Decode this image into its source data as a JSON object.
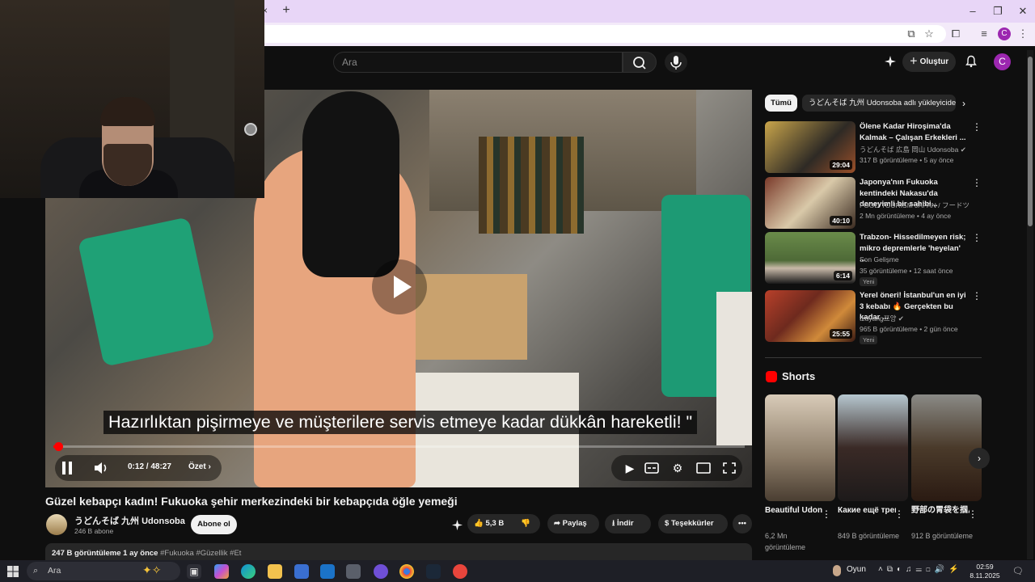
{
  "browser": {
    "tab_close": "×",
    "new_tab": "+",
    "window_controls": {
      "minimize": "–",
      "restore": "❐",
      "close": "✕"
    },
    "profile_initial": "C"
  },
  "header": {
    "search_placeholder": "Ara",
    "create_label": "Oluştur",
    "avatar_initial": "C"
  },
  "player": {
    "subtitle": "Hazırlıktan pişirmeye ve müşterilere servis etmeye kadar dükkân hareketli! \"",
    "time": "0:12 / 48:27",
    "chapter": "Özet",
    "progress": 0.004,
    "state": "paused-hover"
  },
  "video": {
    "title": "Güzel kebapçı kadın! Fukuoka şehir merkezindeki bir kebapçıda öğle yemeği",
    "channel": "うどんそば 九州 Udonsoba",
    "subscribers": "246 B abone",
    "subscribe_label": "Abone ol",
    "likes": "5,3 B",
    "share_label": "Paylaş",
    "download_label": "İndir",
    "thanks_label": "Teşekkürler",
    "views_age": "247 B görüntüleme  1 ay önce",
    "tags": "#Fukuoka #Güzellik #Et"
  },
  "sidebar": {
    "chips": [
      "Tümü",
      "うどんそば 九州 Udonsoba adlı yükleyiciden"
    ],
    "recommendations": [
      {
        "title": "Ölene Kadar Hiroşima'da Kalmak – Çalışan Erkekleri ...",
        "channel": "うどんそば 広島 岡山 Udonsoba ✔",
        "meta": "317 B görüntüleme • 5 ay önce",
        "duration": "29:04",
        "badge": ""
      },
      {
        "title": "Japonya'nın Fukuoka kentindeki Nakasu'da deneyimli bir sahibi...",
        "channel": "FOOD TOURISM JAPAN / フードツーリ...",
        "meta": "2 Mn görüntüleme • 4 ay önce",
        "duration": "40:10",
        "badge": ""
      },
      {
        "title": "Trabzon- Hissedilmeyen risk; mikro depremlerle 'heyelan' ...",
        "channel": "Son Gelişme",
        "meta": "35 görüntüleme • 12 saat önce",
        "duration": "6:14",
        "badge": "Yeni"
      },
      {
        "title": "Yerel öneri! İstanbul'un en iyi 3 kebabı 🔥 Gerçekten bu kadar ...",
        "channel": "tzuyang쯔양 ✔",
        "meta": "965 B görüntüleme • 2 gün önce",
        "duration": "25:55",
        "badge": "Yeni"
      }
    ],
    "shorts_title": "Shorts",
    "shorts": [
      {
        "title": "Beautiful Udon Mast...",
        "views": "6,2 Mn görüntüleme"
      },
      {
        "title": "Какие ещё треки буду...",
        "views": "849 B görüntüleme"
      },
      {
        "title": "野部の胃袋を掴んで離...",
        "views": "912 B görüntüleme"
      }
    ]
  },
  "taskbar": {
    "search_placeholder": "Ara",
    "weather": "Oyun",
    "time": "02:59",
    "date": "8.11.2025"
  },
  "colors": {
    "accent": "#ff0000",
    "background": "#0f0f0f",
    "tabstrip": "#e8d6f7",
    "avatar": "#9c27b0"
  }
}
